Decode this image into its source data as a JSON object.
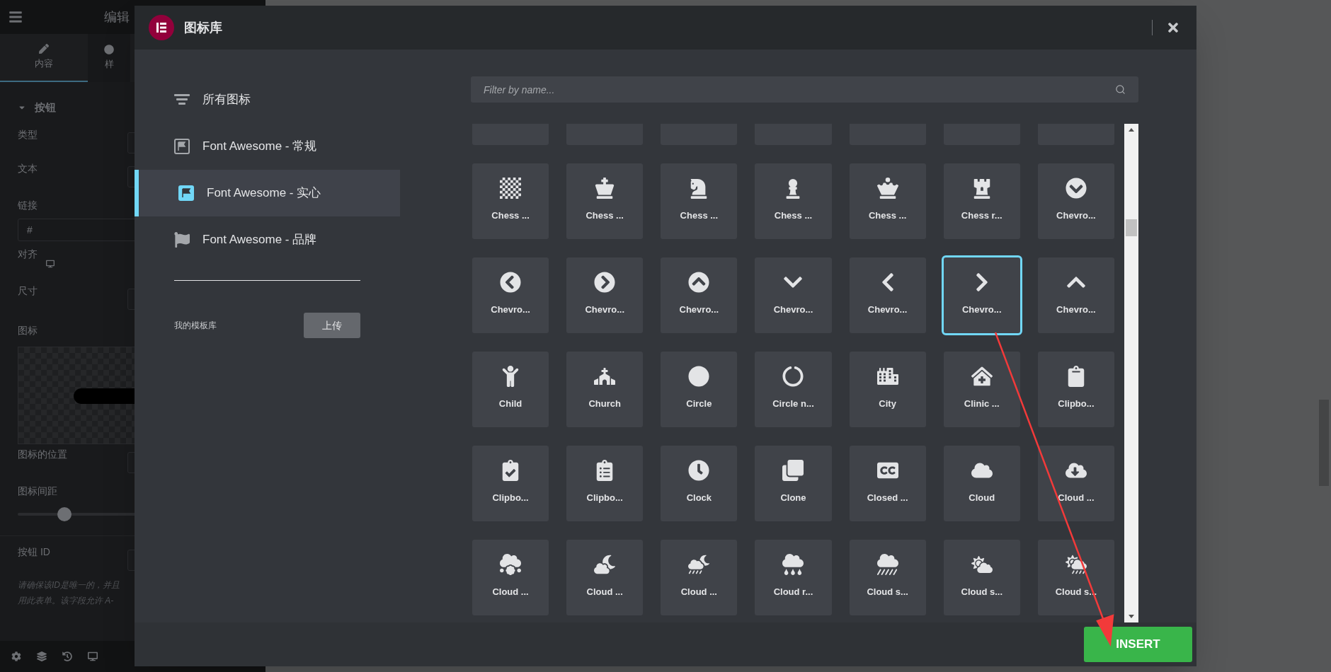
{
  "editor_panel": {
    "title": "编辑",
    "tabs": [
      {
        "label": "内容",
        "selected": true
      },
      {
        "label": "样",
        "selected": false
      }
    ],
    "section": "按钮",
    "fields": [
      {
        "kind": "select",
        "label": "类型"
      },
      {
        "kind": "select",
        "label": "文本"
      },
      {
        "kind": "input",
        "label": "链接",
        "value": "#"
      },
      {
        "kind": "responsive",
        "label": "对齐"
      },
      {
        "kind": "select",
        "label": "尺寸"
      },
      {
        "kind": "preview",
        "label": "图标"
      },
      {
        "kind": "select",
        "label": "图标的位置"
      },
      {
        "kind": "slider",
        "label": "图标间距",
        "level": 0.2
      },
      {
        "kind": "select",
        "label": "按钮 ID"
      }
    ],
    "note": [
      "请确保该ID是唯一的，并且",
      "用此表单。该字段允许 A-"
    ]
  },
  "modal": {
    "title": "图标库",
    "sidebar": {
      "items": [
        {
          "kind": "all",
          "label": "所有图标",
          "selected": false
        },
        {
          "kind": "regular",
          "label": "Font Awesome - 常规",
          "selected": false
        },
        {
          "kind": "solid",
          "label": "Font Awesome - 实心",
          "selected": true
        },
        {
          "kind": "brands",
          "label": "Font Awesome - 品牌",
          "selected": false
        }
      ],
      "library_label": "我的模板库",
      "upload_button": "上传"
    },
    "search": {
      "placeholder": "Filter by name..."
    },
    "icons": [
      {
        "selected": false
      },
      {
        "selected": false
      },
      {
        "selected": false
      },
      {
        "selected": false
      },
      {
        "selected": false
      },
      {
        "selected": false
      },
      {
        "selected": false
      },
      {
        "label": "Chess ...",
        "selected": false
      },
      {
        "label": "Chess ...",
        "selected": false
      },
      {
        "label": "Chess ...",
        "selected": false
      },
      {
        "label": "Chess ...",
        "selected": false
      },
      {
        "label": "Chess ...",
        "selected": false
      },
      {
        "label": "Chess r...",
        "selected": false
      },
      {
        "label": "Chevro...",
        "selected": false
      },
      {
        "label": "Chevro...",
        "selected": false
      },
      {
        "label": "Chevro...",
        "selected": false
      },
      {
        "label": "Chevro...",
        "selected": false
      },
      {
        "label": "Chevro...",
        "selected": false
      },
      {
        "label": "Chevro...",
        "selected": false
      },
      {
        "label": "Chevro...",
        "selected": true
      },
      {
        "label": "Chevro...",
        "selected": false
      },
      {
        "label": "Child",
        "selected": false
      },
      {
        "label": "Church",
        "selected": false
      },
      {
        "label": "Circle",
        "selected": false
      },
      {
        "label": "Circle n...",
        "selected": false
      },
      {
        "label": "City",
        "selected": false
      },
      {
        "label": "Clinic ...",
        "selected": false
      },
      {
        "label": "Clipbo...",
        "selected": false
      },
      {
        "label": "Clipbo...",
        "selected": false
      },
      {
        "label": "Clipbo...",
        "selected": false
      },
      {
        "label": "Clock",
        "selected": false
      },
      {
        "label": "Clone",
        "selected": false
      },
      {
        "label": "Closed ...",
        "selected": false
      },
      {
        "label": "Cloud",
        "selected": false
      },
      {
        "label": "Cloud ...",
        "selected": false
      },
      {
        "label": "Cloud ...",
        "selected": false
      },
      {
        "label": "Cloud ...",
        "selected": false
      },
      {
        "label": "Cloud ...",
        "selected": false
      },
      {
        "label": "Cloud r...",
        "selected": false
      },
      {
        "label": "Cloud s...",
        "selected": false
      },
      {
        "label": "Cloud s...",
        "selected": false
      },
      {
        "label": "Cloud s...",
        "selected": false
      }
    ],
    "insert_button": "INSERT"
  }
}
